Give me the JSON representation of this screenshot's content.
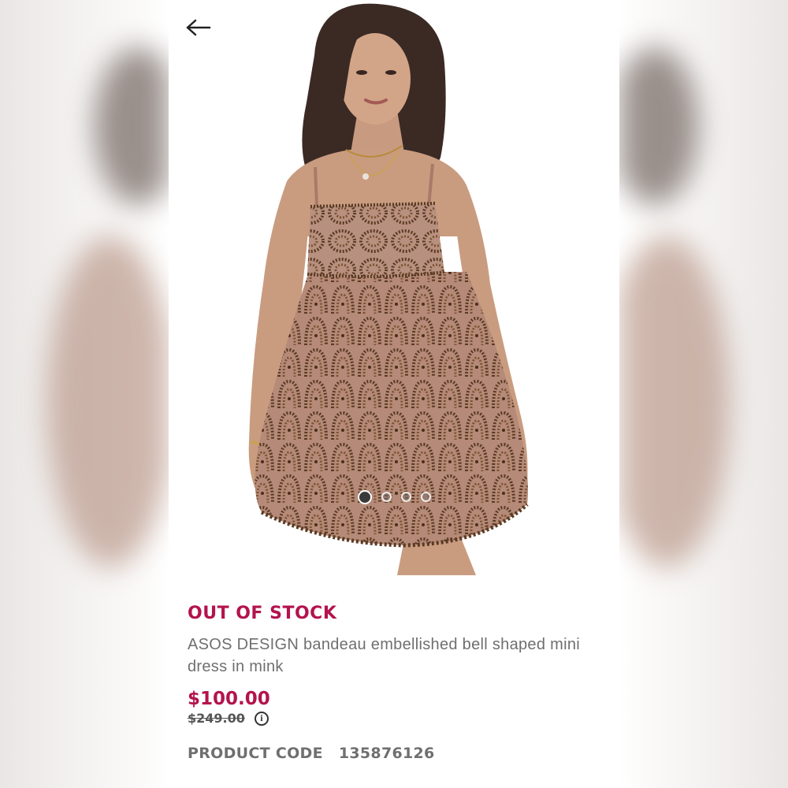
{
  "nav": {
    "back_icon": "arrow-left-icon"
  },
  "gallery": {
    "image_count": 4,
    "active_index": 0
  },
  "product": {
    "stock_status": "OUT OF STOCK",
    "title": "ASOS DESIGN bandeau embellished bell shaped mini dress in mink",
    "price": "$100.00",
    "original_price": "$249.00",
    "info_icon": "info-icon",
    "code_label": "PRODUCT CODE",
    "code_value": "135876126"
  },
  "colors": {
    "accent": "#b3134d",
    "muted_text": "#6f6f6f",
    "dress": "#b58a78",
    "beads": "#5a3a22"
  }
}
